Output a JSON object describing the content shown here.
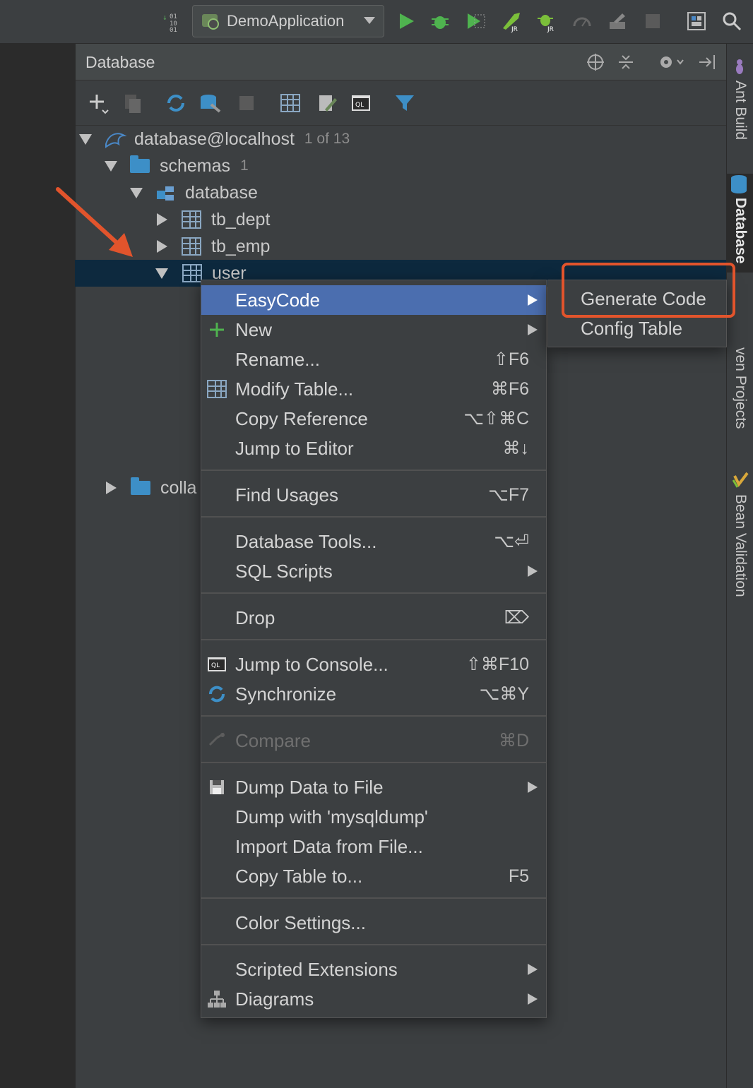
{
  "toolbar": {
    "run_config": "DemoApplication"
  },
  "panel": {
    "title": "Database"
  },
  "tree": {
    "connection": "database@localhost",
    "connection_count": "1 of 13",
    "schemas": "schemas",
    "schemas_count": "1",
    "schema": "database",
    "tables": [
      "tb_dept",
      "tb_emp",
      "user"
    ],
    "collations": "colla"
  },
  "context_menu": {
    "items": [
      {
        "label": "EasyCode",
        "shortcut": ""
      },
      {
        "label": "New",
        "shortcut": ""
      },
      {
        "label": "Rename...",
        "shortcut": "⇧F6"
      },
      {
        "label": "Modify Table...",
        "shortcut": "⌘F6"
      },
      {
        "label": "Copy Reference",
        "shortcut": "⌥⇧⌘C"
      },
      {
        "label": "Jump to Editor",
        "shortcut": "⌘↓"
      },
      {
        "label": "Find Usages",
        "shortcut": "⌥F7"
      },
      {
        "label": "Database Tools...",
        "shortcut": "⌥⏎"
      },
      {
        "label": "SQL Scripts",
        "shortcut": ""
      },
      {
        "label": "Drop",
        "shortcut": "⌦"
      },
      {
        "label": "Jump to Console...",
        "shortcut": "⇧⌘F10"
      },
      {
        "label": "Synchronize",
        "shortcut": "⌥⌘Y"
      },
      {
        "label": "Compare",
        "shortcut": "⌘D"
      },
      {
        "label": "Dump Data to File",
        "shortcut": ""
      },
      {
        "label": "Dump with 'mysqldump'",
        "shortcut": ""
      },
      {
        "label": "Import Data from File...",
        "shortcut": ""
      },
      {
        "label": "Copy Table to...",
        "shortcut": "F5"
      },
      {
        "label": "Color Settings...",
        "shortcut": ""
      },
      {
        "label": "Scripted Extensions",
        "shortcut": ""
      },
      {
        "label": "Diagrams",
        "shortcut": ""
      }
    ]
  },
  "submenu": {
    "items": [
      "Generate Code",
      "Config Table"
    ]
  },
  "side_tabs": {
    "ant_build": "Ant Build",
    "database": "Database",
    "maven": "ven Projects",
    "bean_validation": "Bean Validation"
  },
  "colors": {
    "highlight": "#4b6eaf",
    "annotation": "#e2542c",
    "selection": "#0d293e"
  }
}
